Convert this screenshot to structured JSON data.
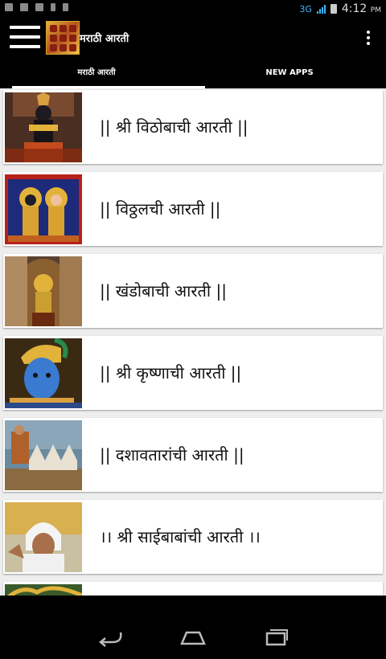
{
  "status_bar": {
    "network": "3G",
    "time": "4:12",
    "ampm": "PM"
  },
  "app": {
    "title": "मराठी आरती"
  },
  "tabs": [
    {
      "label": "मराठी आरती"
    },
    {
      "label": "NEW APPS"
    }
  ],
  "items": [
    {
      "label": "|| श्री विठोबाची आरती  ||"
    },
    {
      "label": "|| विठ्ठलची आरती ||"
    },
    {
      "label": "|| खंडोबाची आरती ||"
    },
    {
      "label": "|| श्री कृष्णाची आरती ||"
    },
    {
      "label": "|| दशावतारांची आरती ||"
    },
    {
      "label": "।। श्री साईबाबांची आरती ।।"
    },
    {
      "label": ""
    }
  ]
}
